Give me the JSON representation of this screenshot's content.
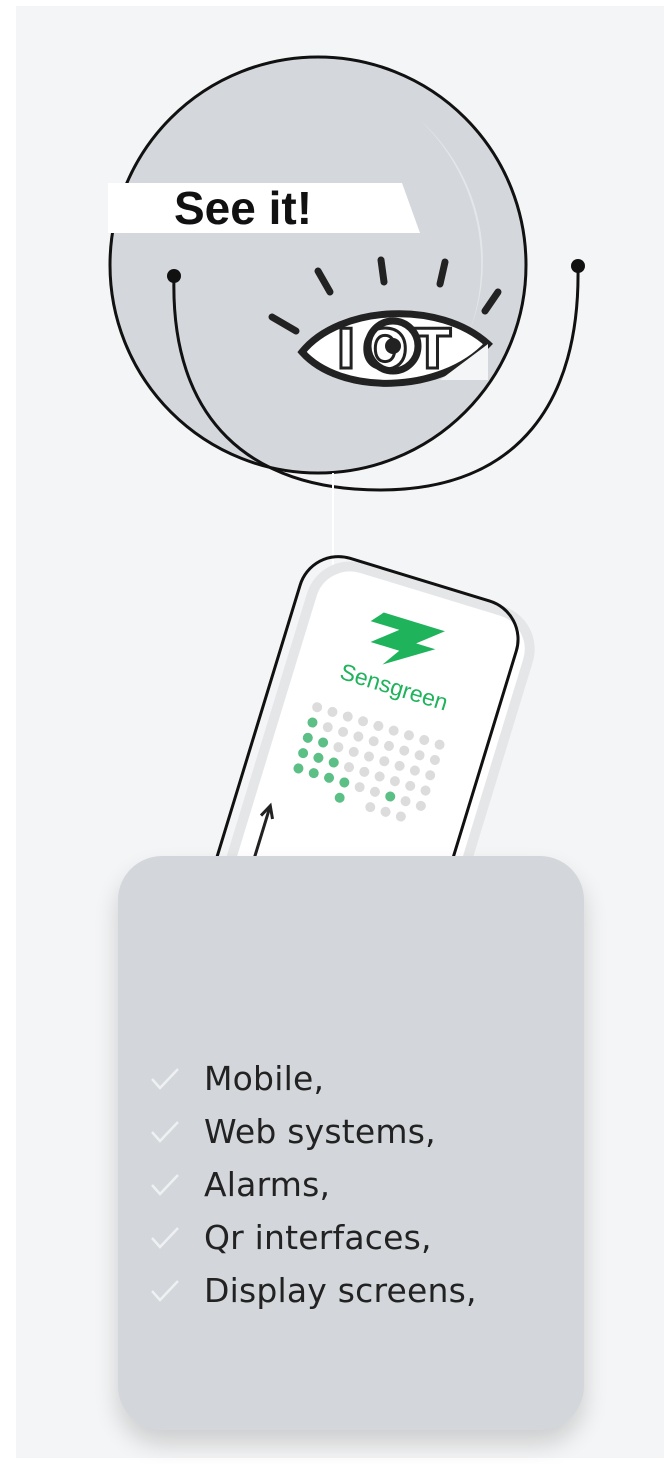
{
  "badge": {
    "label": "See it!"
  },
  "eye": {
    "label": "IOT"
  },
  "phone": {
    "brand": "Sensgreen",
    "brand_color": "#1fb35b"
  },
  "features": [
    {
      "label": "Mobile,"
    },
    {
      "label": "Web systems,"
    },
    {
      "label": "Alarms,"
    },
    {
      "label": "Qr interfaces,"
    },
    {
      "label": "Display screens,"
    }
  ],
  "colors": {
    "panel": "#f4f5f6",
    "card": "#d3d7db",
    "circle": "#d4d8dc",
    "accent": "#1fb35b",
    "ink": "#111111"
  }
}
